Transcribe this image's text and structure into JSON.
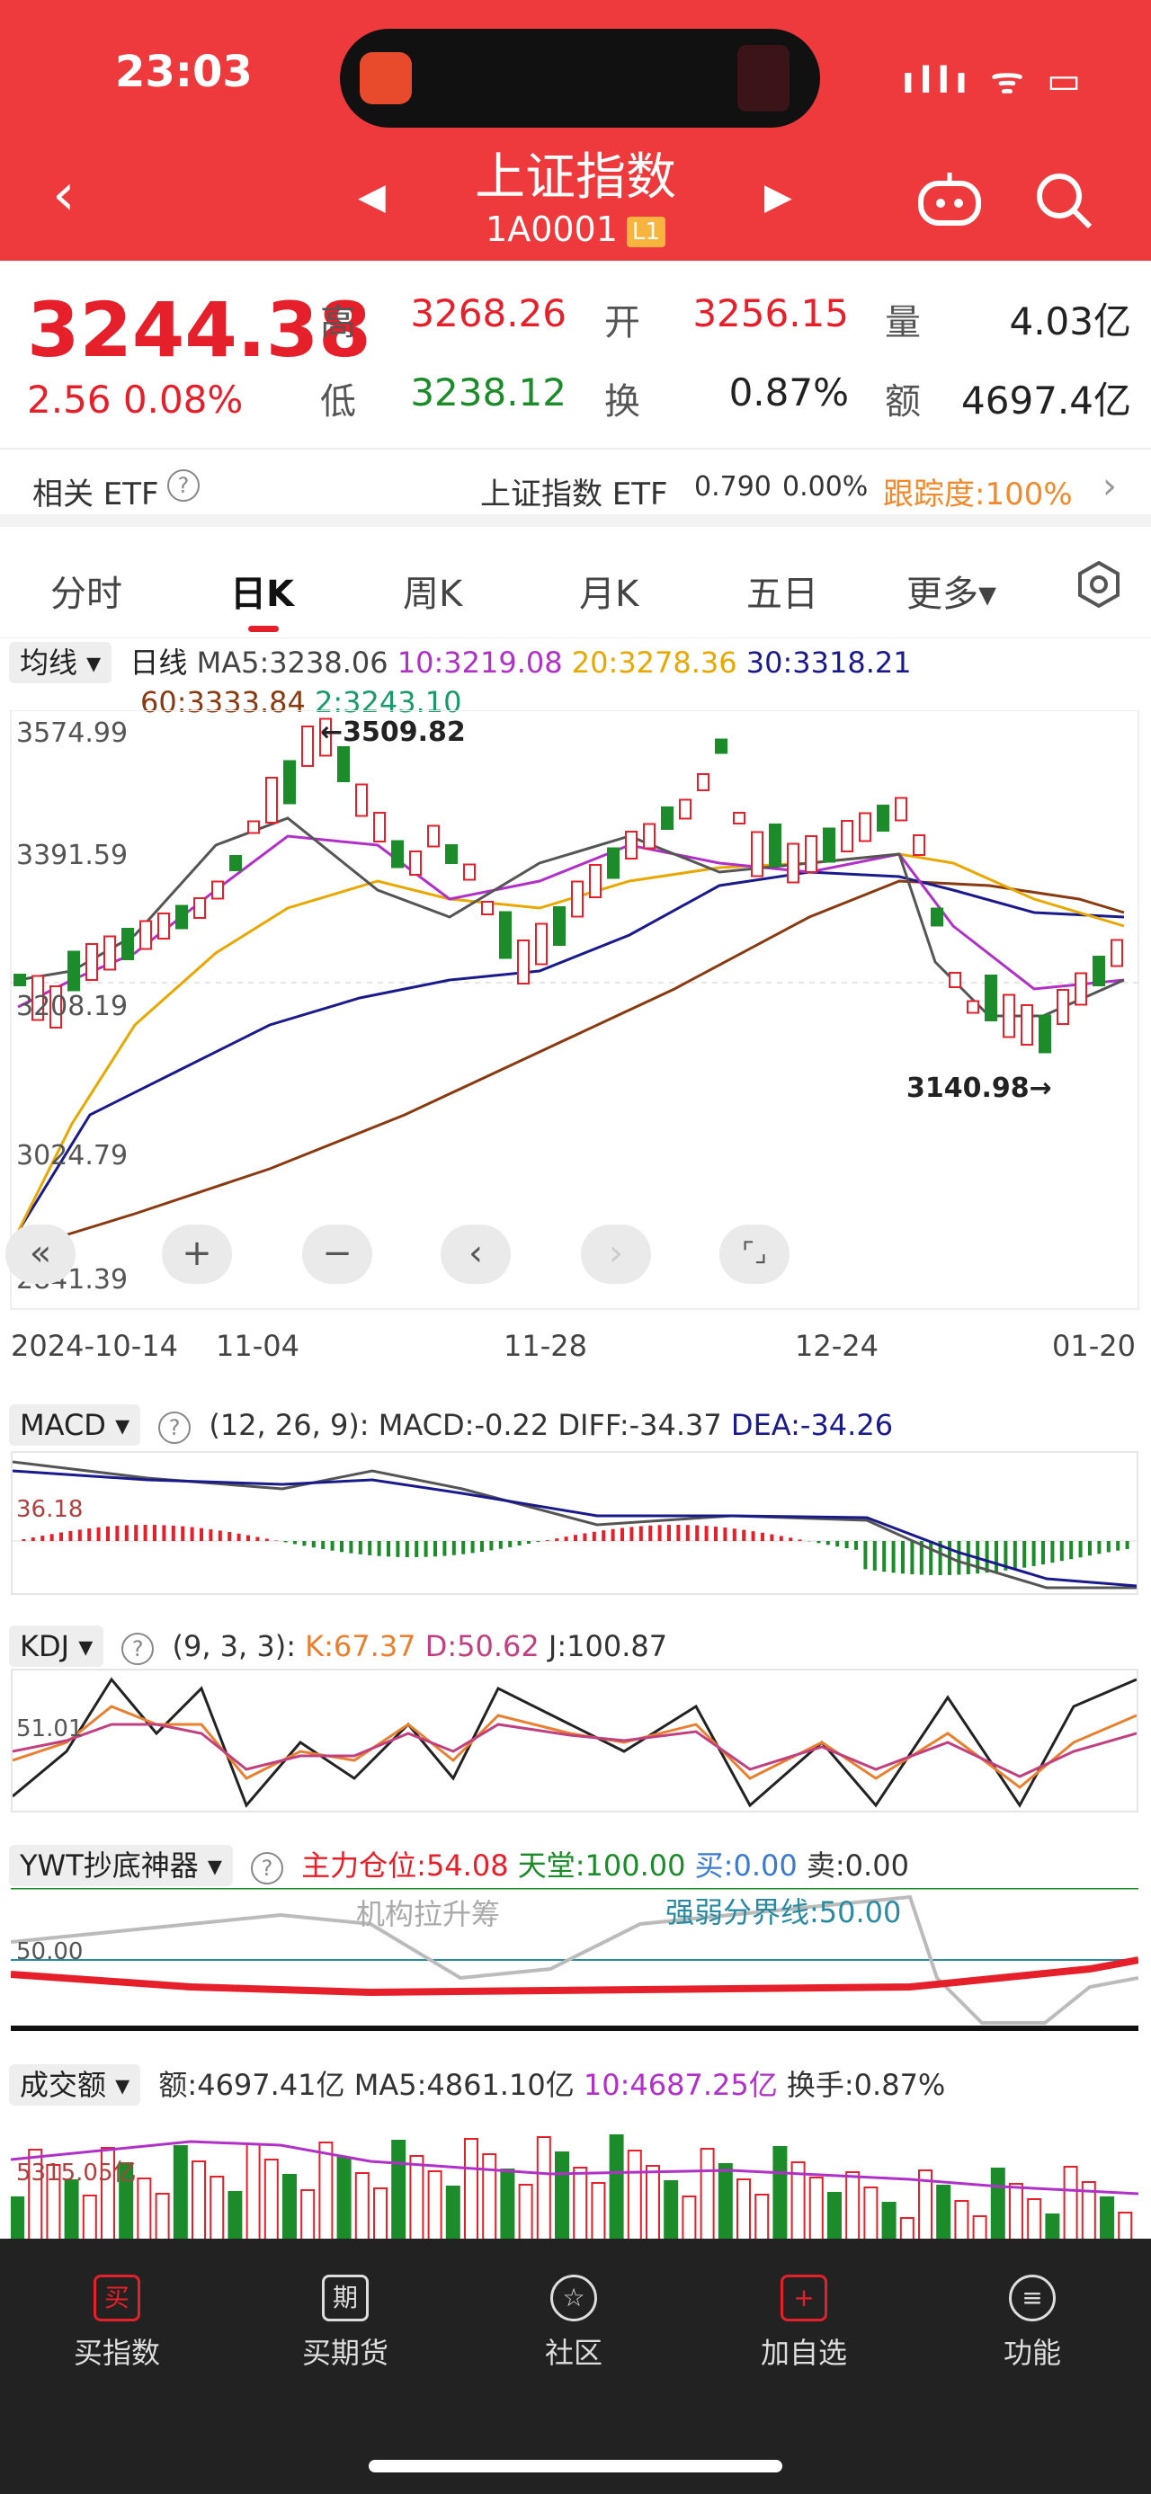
{
  "status": {
    "time": "23:03",
    "right": "ıllı ᯤ ▭"
  },
  "header": {
    "title": "上证指数",
    "code": "1A0001",
    "level": "L1"
  },
  "quote": {
    "price": "3244.38",
    "change": "2.56  0.08%",
    "high_label": "高",
    "high": "3268.26",
    "open_label": "开",
    "open": "3256.15",
    "volume_label": "量",
    "volume": "4.03亿",
    "low_label": "低",
    "low": "3238.12",
    "turnover_label": "换",
    "turnover": "0.87%",
    "amount_label": "额",
    "amount": "4697.4亿"
  },
  "etf": {
    "label": "相关 ETF",
    "name": "上证指数 ETF",
    "price": "0.790",
    "pct": "0.00%",
    "tracking": "跟踪度:100%"
  },
  "tabs": [
    "分时",
    "日K",
    "周K",
    "月K",
    "五日",
    "更多▾"
  ],
  "ma": {
    "selector": "均线 ▾",
    "period": "日线",
    "ma5": "MA5:3238.06",
    "ma10": "10:3219.08",
    "ma20": "20:3278.36",
    "ma30": "30:3318.21",
    "ma60": "60:3333.84",
    "ma2": "2:3243.10"
  },
  "kchart": {
    "y_labels": [
      "3574.99",
      "3391.59",
      "3208.19",
      "3024.79",
      "2841.39"
    ],
    "high_marker": "←3509.82",
    "low_marker": "3140.98→",
    "dates": [
      "2024-10-14",
      "11-04",
      "11-28",
      "12-24",
      "01-20"
    ],
    "ctrl": [
      "«",
      "+",
      "−",
      "‹",
      "›",
      "⌜⌟"
    ]
  },
  "macd": {
    "selector": "MACD ▾",
    "params": "(12, 26, 9):",
    "macd": "MACD:-0.22",
    "diff": "DIFF:-34.37",
    "dea": "DEA:-34.26",
    "axis": "36.18"
  },
  "kdj": {
    "selector": "KDJ ▾",
    "params": "(9, 3, 3):",
    "k": "K:67.37",
    "d": "D:50.62",
    "j": "J:100.87",
    "axis": "51.01"
  },
  "ywt": {
    "selector": "YWT抄底神器 ▾",
    "main": "主力仓位:54.08",
    "heaven": "天堂:100.00",
    "buy": "买:0.00",
    "sell": "卖:0.00",
    "note1": "机构拉升筹",
    "note2": "强弱分界线:50.00",
    "axis": "50.00"
  },
  "amount_panel": {
    "selector": "成交额 ▾",
    "amount": "额:4697.41亿",
    "ma5": "MA5:4861.10亿",
    "ma10": "10:4687.25亿",
    "turnover": "换手:0.87%",
    "axis": "5315.05亿"
  },
  "bottom": [
    {
      "icon": "买",
      "label": "买指数"
    },
    {
      "icon": "期",
      "label": "买期货"
    },
    {
      "icon": "☆",
      "label": "社区"
    },
    {
      "icon": "+",
      "label": "加自选"
    },
    {
      "icon": "≡",
      "label": "功能"
    }
  ],
  "colors": {
    "header_red": "#ee3a3c",
    "up_red": "#e5202a",
    "down_green": "#1c8c2a"
  },
  "chart_data": {
    "type": "candlestick",
    "title": "上证指数 日K",
    "ylim": [
      2841.39,
      3574.99
    ],
    "x": [
      "2024-10-14",
      "11-04",
      "11-28",
      "12-24",
      "01-20"
    ],
    "high": 3509.82,
    "low": 3140.98,
    "last_close": 3244.38
  }
}
